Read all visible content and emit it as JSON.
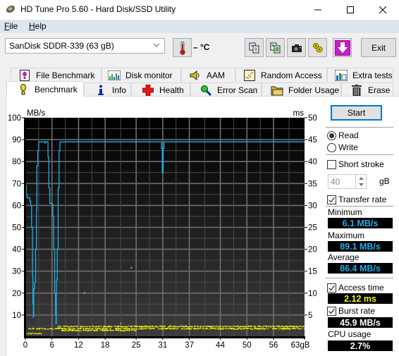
{
  "window": {
    "title": "HD Tune Pro 5.60 - Hard Disk/SSD Utility",
    "controls": [
      "minimize",
      "maximize",
      "close"
    ]
  },
  "menu": {
    "items": [
      {
        "label": "File",
        "accel": "F"
      },
      {
        "label": "Help",
        "accel": "H"
      }
    ]
  },
  "toolbar": {
    "drive": "SanDisk SDDR-339 (63 gB)",
    "temperature": "– °C",
    "icons": [
      "thermometer-icon",
      "copy-text-icon",
      "copy-screenshot-icon",
      "camera-icon",
      "options-icon",
      "save-download-icon"
    ],
    "exit_label": "Exit"
  },
  "tabs": {
    "row1": [
      {
        "label": "File Benchmark",
        "icon": "file-benchmark-icon"
      },
      {
        "label": "Disk monitor",
        "icon": "disk-monitor-icon"
      },
      {
        "label": "AAM",
        "icon": "speaker-icon"
      },
      {
        "label": "Random Access",
        "icon": "random-access-icon"
      },
      {
        "label": "Extra tests",
        "icon": "extra-tests-icon"
      }
    ],
    "row2": [
      {
        "label": "Benchmark",
        "icon": "benchmark-icon",
        "active": true
      },
      {
        "label": "Info",
        "icon": "info-icon"
      },
      {
        "label": "Health",
        "icon": "health-cross-icon"
      },
      {
        "label": "Error Scan",
        "icon": "magnifier-icon"
      },
      {
        "label": "Folder Usage",
        "icon": "folder-icon"
      },
      {
        "label": "Erase",
        "icon": "trash-icon"
      }
    ]
  },
  "controls": {
    "start_label": "Start",
    "mode": {
      "options": [
        "Read",
        "Write"
      ],
      "selected": "Read"
    },
    "short_stroke": {
      "label": "Short stroke",
      "checked": false,
      "value": "40",
      "unit": "gB"
    },
    "transfer_rate": {
      "label": "Transfer rate",
      "checked": true
    },
    "minimum": {
      "label": "Minimum",
      "value": "6.1 MB/s"
    },
    "maximum": {
      "label": "Maximum",
      "value": "89.1 MB/s"
    },
    "average": {
      "label": "Average",
      "value": "86.4 MB/s"
    },
    "access_time": {
      "label": "Access time",
      "checked": true,
      "value": "2.12 ms"
    },
    "burst_rate": {
      "label": "Burst rate",
      "checked": true,
      "value": "45.9 MB/s"
    },
    "cpu_usage": {
      "label": "CPU usage",
      "value": "2.7%"
    }
  },
  "colors": {
    "transfer_line": "#1eaee6",
    "access_points": "#f5f500",
    "stat_blue": "#1eaee6",
    "stat_yellow": "#f5f500",
    "stat_white": "#ffffff",
    "focus_border": "#0078d7"
  },
  "chart_data": {
    "type": "line",
    "title": "",
    "xlabel": "gB",
    "ylabel": "MB/s",
    "y2label": "ms",
    "xlim": [
      0,
      63
    ],
    "ylim": [
      0,
      100
    ],
    "y2lim": [
      0,
      50
    ],
    "x_ticks": [
      "0",
      "6",
      "12",
      "18",
      "25",
      "31",
      "37",
      "44",
      "50",
      "56",
      "63gB"
    ],
    "x_tick_values": [
      0,
      6,
      12,
      18,
      25,
      31,
      37,
      44,
      50,
      56,
      63
    ],
    "y_ticks": [
      10,
      20,
      30,
      40,
      50,
      60,
      70,
      80,
      90,
      100
    ],
    "y2_ticks": [
      5,
      10,
      15,
      20,
      25,
      30,
      35,
      40,
      45,
      50
    ],
    "grid": true,
    "series": [
      {
        "name": "Transfer rate (MB/s)",
        "axis": "left",
        "points": [
          [
            0,
            69
          ],
          [
            0.2,
            65
          ],
          [
            0.4,
            63.5
          ],
          [
            0.8,
            63.5
          ],
          [
            1.0,
            62
          ],
          [
            1.2,
            60
          ],
          [
            1.4,
            50
          ],
          [
            1.6,
            28
          ],
          [
            1.7,
            15
          ],
          [
            1.8,
            9
          ],
          [
            1.9,
            22
          ],
          [
            2.1,
            25
          ],
          [
            2.3,
            40
          ],
          [
            2.5,
            58
          ],
          [
            2.6,
            78
          ],
          [
            2.8,
            85
          ],
          [
            3.0,
            89
          ],
          [
            4.2,
            89
          ],
          [
            4.4,
            88.5
          ],
          [
            4.6,
            89
          ],
          [
            5.0,
            89
          ],
          [
            5.1,
            82
          ],
          [
            5.3,
            68
          ],
          [
            5.5,
            61
          ],
          [
            6.0,
            60.5
          ],
          [
            6.2,
            55
          ],
          [
            6.4,
            40
          ],
          [
            6.6,
            20
          ],
          [
            6.8,
            10
          ],
          [
            6.9,
            6.1
          ],
          [
            7.0,
            26
          ],
          [
            7.2,
            40
          ],
          [
            7.4,
            68
          ],
          [
            7.6,
            85
          ],
          [
            7.8,
            89
          ],
          [
            8.5,
            89
          ],
          [
            10,
            89
          ],
          [
            15,
            89
          ],
          [
            20,
            89
          ],
          [
            25,
            89
          ],
          [
            30.5,
            89
          ],
          [
            30.7,
            86
          ],
          [
            30.9,
            75
          ],
          [
            31.1,
            86
          ],
          [
            31.3,
            89
          ],
          [
            35,
            89
          ],
          [
            40,
            89
          ],
          [
            45,
            89
          ],
          [
            50,
            89
          ],
          [
            56,
            89
          ],
          [
            63,
            89
          ]
        ]
      },
      {
        "name": "Access time (ms)",
        "axis": "right",
        "style": "scatter",
        "bands": [
          {
            "x_from": 0.2,
            "x_to": 3.6,
            "ms": 0.8
          },
          {
            "x_from": 0.5,
            "x_to": 63,
            "ms": 1.9
          },
          {
            "x_from": 7.0,
            "x_to": 63,
            "ms": 2.4
          },
          {
            "x_from": 8.0,
            "x_to": 25,
            "ms": 1.5
          }
        ],
        "outliers": [
          [
            13.2,
            10.2
          ],
          [
            23.8,
            15.9
          ],
          [
            21.4,
            3.2
          ]
        ]
      }
    ]
  }
}
